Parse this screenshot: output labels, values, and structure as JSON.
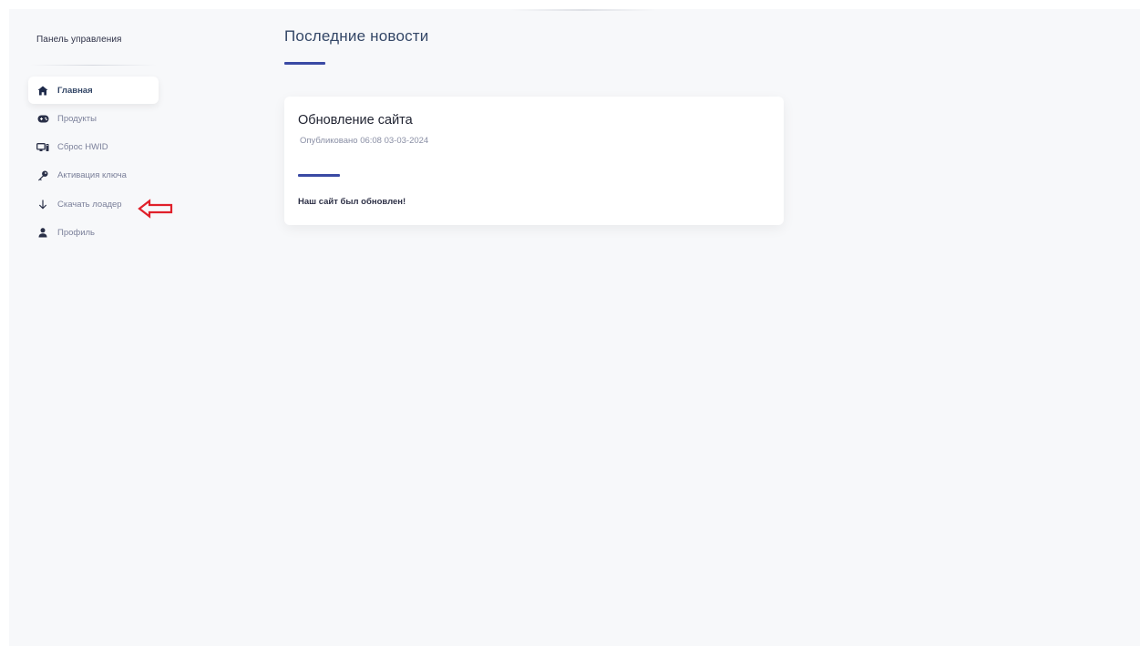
{
  "sidebar": {
    "brand": "Панель управления",
    "items": [
      {
        "label": "Главная",
        "icon": "home-icon",
        "active": true
      },
      {
        "label": "Продукты",
        "icon": "gamepad-icon",
        "active": false
      },
      {
        "label": "Сброс HWID",
        "icon": "monitor-icon",
        "active": false
      },
      {
        "label": "Активация ключа",
        "icon": "key-icon",
        "active": false
      },
      {
        "label": "Скачать лоадер",
        "icon": "arrow-down-icon",
        "active": false
      },
      {
        "label": "Профиль",
        "icon": "user-icon",
        "active": false
      }
    ]
  },
  "main": {
    "title": "Последние новости",
    "news": [
      {
        "title": "Обновление сайта",
        "date": "Опубликовано 06:08 03-03-2024",
        "body": "Наш сайт был обновлен!"
      }
    ]
  },
  "colors": {
    "accent": "#3a4aa4",
    "background": "#f7f8fa",
    "annotation_arrow": "#e0202a"
  }
}
